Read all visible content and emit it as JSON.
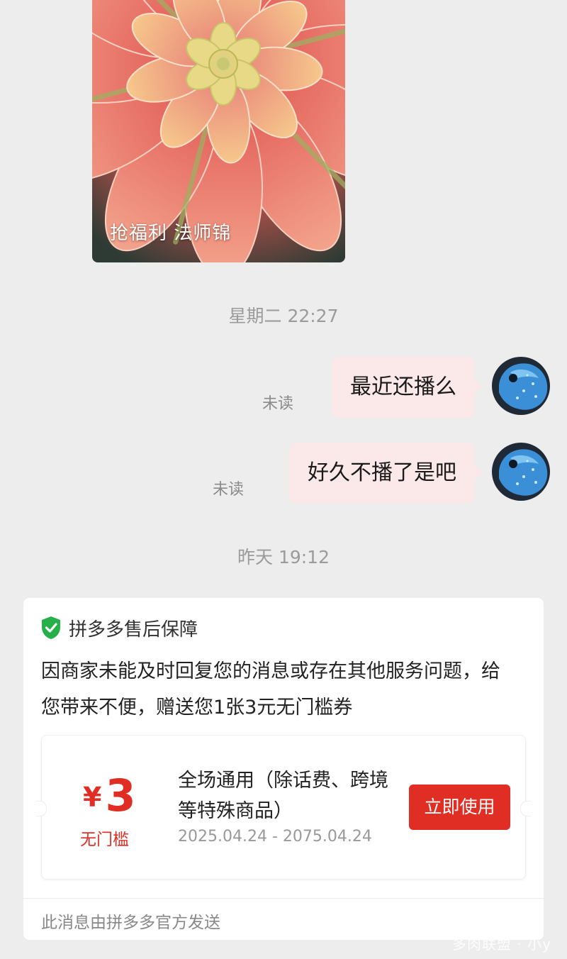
{
  "product": {
    "caption": "抢福利 法师锦"
  },
  "chat": {
    "timestamps": {
      "first": "星期二 22:27",
      "second": "昨天 19:12"
    },
    "messages": [
      {
        "text": "最近还播么",
        "status": "未读"
      },
      {
        "text": "好久不播了是吧",
        "status": "未读"
      }
    ]
  },
  "service_card": {
    "shield_icon": "shield-check-icon",
    "title": "拼多多售后保障",
    "message": "因商家未能及时回复您的消息或存在其他服务问题，给您带来不便，赠送您1张3元无门槛券",
    "coupon": {
      "currency": "¥",
      "amount": "3",
      "threshold": "无门槛",
      "description": "全场通用（除话费、跨境等特殊商品）",
      "validity": "2025.04.24 - 2075.04.24",
      "button_label": "立即使用",
      "accent_color": "#e02e24"
    },
    "footer": "此消息由拼多多官方发送"
  },
  "watermark": "多肉联盟 · 小y"
}
